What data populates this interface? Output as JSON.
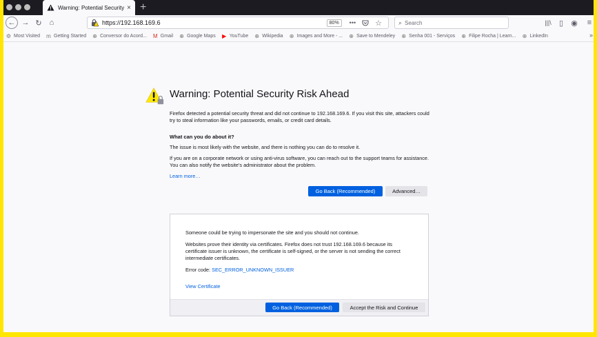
{
  "tab": {
    "title": "Warning: Potential Security Risk Ahead",
    "close": "×",
    "new_tab": "+"
  },
  "nav": {
    "url": "https://192.168.169.6",
    "zoom": "80%",
    "more_icon": "•••",
    "search_placeholder": "Search"
  },
  "bookmarks": [
    {
      "icon": "gear-icon",
      "glyph": "⚙",
      "label": "Most Visited"
    },
    {
      "icon": "mozilla-icon",
      "glyph": "m",
      "label": "Getting Started"
    },
    {
      "icon": "globe-icon",
      "glyph": "⊕",
      "label": "Conversor do Acord..."
    },
    {
      "icon": "gmail-icon",
      "glyph": "M",
      "label": "Gmail"
    },
    {
      "icon": "globe-icon",
      "glyph": "⊕",
      "label": "Google Maps"
    },
    {
      "icon": "youtube-icon",
      "glyph": "▶",
      "label": "YouTube"
    },
    {
      "icon": "globe-icon",
      "glyph": "⊕",
      "label": "Wikipedia"
    },
    {
      "icon": "globe-icon",
      "glyph": "⊕",
      "label": "Images and More - ..."
    },
    {
      "icon": "globe-icon",
      "glyph": "⊕",
      "label": "Save to Mendeley"
    },
    {
      "icon": "globe-icon",
      "glyph": "⊕",
      "label": "Senha 001 - Serviços"
    },
    {
      "icon": "globe-icon",
      "glyph": "⊕",
      "label": "Filipe Rocha | Learn..."
    },
    {
      "icon": "globe-icon",
      "glyph": "⊕",
      "label": "LinkedIn"
    }
  ],
  "page": {
    "title": "Warning: Potential Security Risk Ahead",
    "intro": "Firefox detected a potential security threat and did not continue to 192.168.169.6. If you visit this site, attackers could try to steal information like your passwords, emails, or credit card details.",
    "what_heading": "What can you do about it?",
    "issue_text": "The issue is most likely with the website, and there is nothing you can do to resolve it.",
    "corporate_text": "If you are on a corporate network or using anti-virus software, you can reach out to the support teams for assistance. You can also notify the website’s administrator about the problem.",
    "learn_more": "Learn more…",
    "go_back": "Go Back (Recommended)",
    "advanced": "Advanced…"
  },
  "advanced_panel": {
    "impersonate": "Someone could be trying to impersonate the site and you should not continue.",
    "cert_text": "Websites prove their identity via certificates. Firefox does not trust 192.168.169.6 because its certificate issuer is unknown, the certificate is self-signed, or the server is not sending the correct intermediate certificates.",
    "error_label": "Error code: ",
    "error_code": "SEC_ERROR_UNKNOWN_ISSUER",
    "view_cert": "View Certificate",
    "go_back": "Go Back (Recommended)",
    "accept": "Accept the Risk and Continue"
  },
  "colors": {
    "accent": "#0060df",
    "warning": "#ffe900",
    "frame": "#ffe600"
  }
}
